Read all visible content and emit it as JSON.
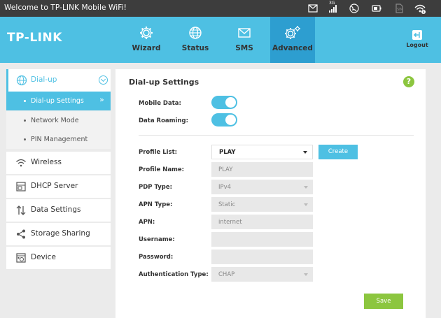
{
  "statusbar": {
    "welcome": "Welcome to TP-LINK Mobile WiFi!",
    "network_type": "3G",
    "icons": [
      "mail-icon",
      "signal-icon",
      "globe-icon",
      "battery-icon",
      "sim-icon",
      "wifi-icon"
    ]
  },
  "header": {
    "logo": "TP-LINK",
    "nav": [
      {
        "label": "Wizard",
        "icon": "gear-icon"
      },
      {
        "label": "Status",
        "icon": "globe-icon"
      },
      {
        "label": "SMS",
        "icon": "envelope-icon"
      },
      {
        "label": "Advanced",
        "icon": "gears-icon",
        "active": true
      }
    ],
    "logout": "Logout"
  },
  "sidebar": {
    "dialup": {
      "label": "Dial-up",
      "items": [
        {
          "label": "Dial-up Settings",
          "active": true
        },
        {
          "label": "Network Mode"
        },
        {
          "label": "PIN Management"
        }
      ]
    },
    "sections": [
      {
        "label": "Wireless",
        "icon": "wifi-icon"
      },
      {
        "label": "DHCP Server",
        "icon": "server-icon"
      },
      {
        "label": "Data Settings",
        "icon": "arrows-icon"
      },
      {
        "label": "Storage Sharing",
        "icon": "share-icon"
      },
      {
        "label": "Device",
        "icon": "device-icon"
      }
    ]
  },
  "main": {
    "title": "Dial-up Settings",
    "help": "?",
    "mobile_data_label": "Mobile Data:",
    "mobile_data_on": true,
    "data_roaming_label": "Data Roaming:",
    "data_roaming_on": true,
    "profile_list_label": "Profile List:",
    "profile_list_value": "PLAY",
    "create_label": "Create",
    "profile_name_label": "Profile Name:",
    "profile_name_value": "PLAY",
    "pdp_type_label": "PDP Type:",
    "pdp_type_value": "IPv4",
    "apn_type_label": "APN Type:",
    "apn_type_value": "Static",
    "apn_label": "APN:",
    "apn_value": "internet",
    "username_label": "Username:",
    "username_value": "",
    "password_label": "Password:",
    "password_value": "",
    "auth_type_label": "Authentication Type:",
    "auth_type_value": "CHAP",
    "save_label": "Save"
  },
  "colors": {
    "header": "#4ec0e3",
    "header_active": "#2d9ed0",
    "statusbar": "#3d3d3d",
    "save": "#8cc63f"
  }
}
